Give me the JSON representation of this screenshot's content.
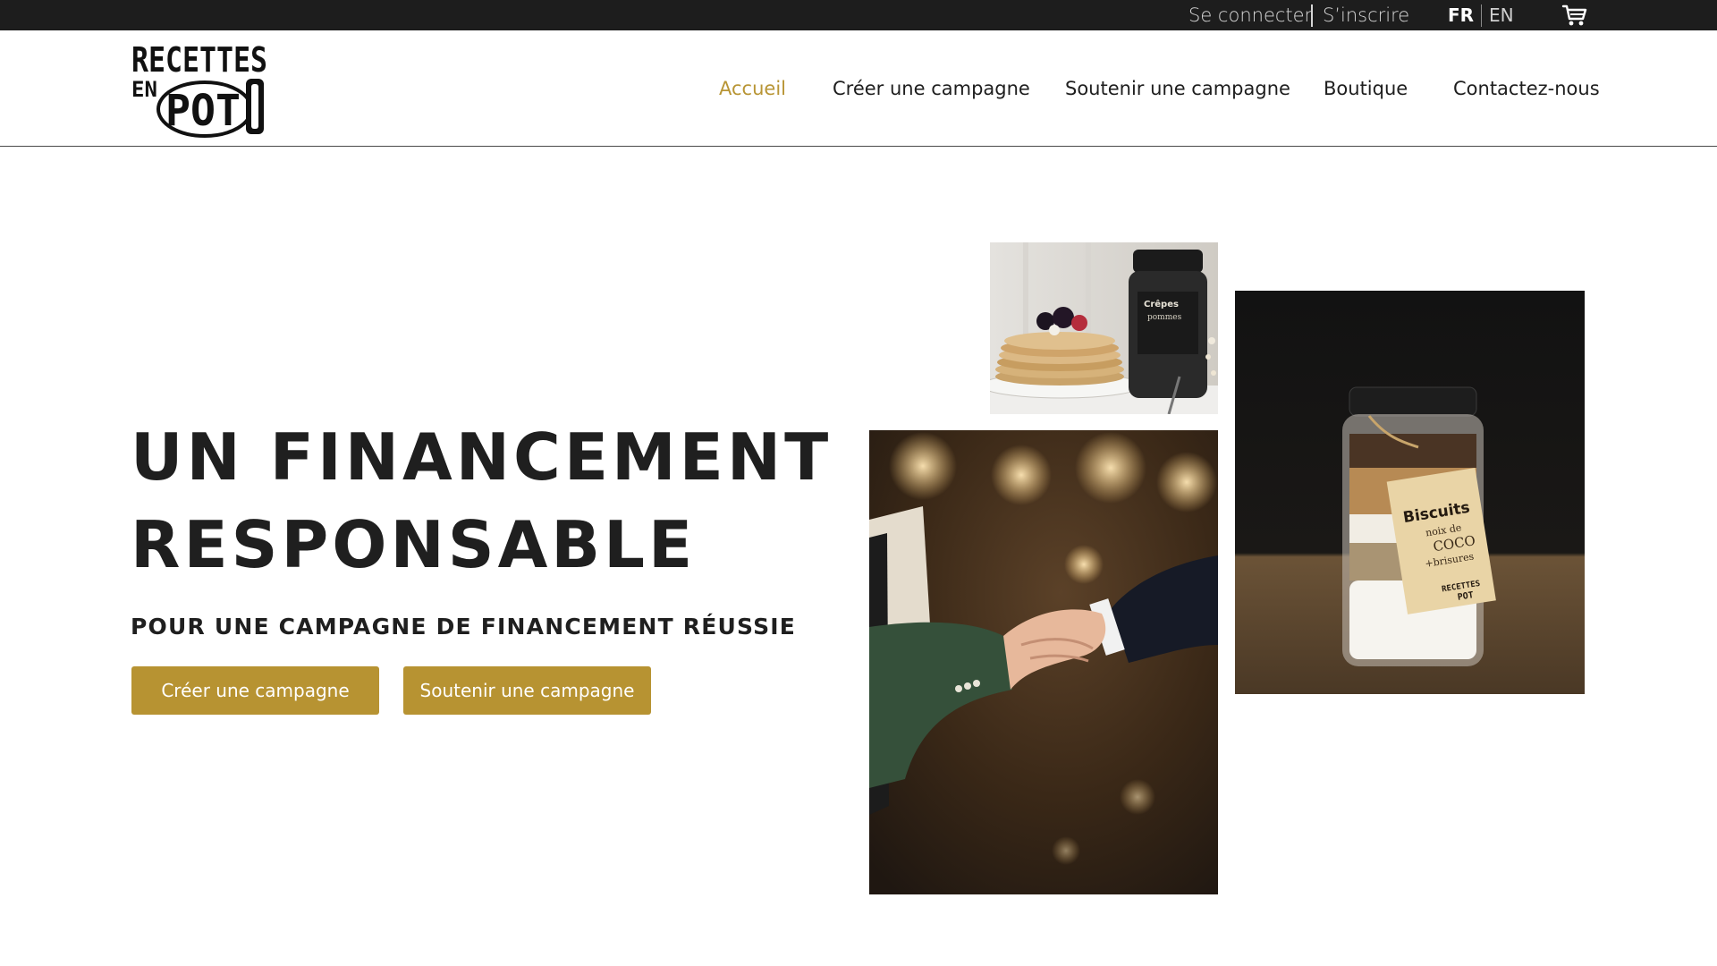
{
  "topbar": {
    "login": "Se connecter",
    "signup": "S’inscrire",
    "lang_fr": "FR",
    "lang_en": "EN",
    "cart_icon": "cart-icon"
  },
  "logo": {
    "line1": "RECETTES",
    "line2": "EN",
    "line3": "POT"
  },
  "nav": {
    "home": "Accueil",
    "create": "Créer une campagne",
    "support": "Soutenir une campagne",
    "shop": "Boutique",
    "contact": "Contactez-nous"
  },
  "hero": {
    "title_line1": "UN FINANCEMENT",
    "title_line2": "RESPONSABLE",
    "subtitle": "POUR UNE CAMPAGNE DE FINANCEMENT RÉUSSIE",
    "btn_create": "Créer une campagne",
    "btn_support": "Soutenir une campagne"
  },
  "photos": {
    "crepes_jar_label_1": "Crêpes",
    "crepes_jar_label_2": "pommes",
    "jar_tag_title": "Biscuits",
    "jar_tag_line1": "noix de",
    "jar_tag_line2": "COCO",
    "jar_tag_line3": "+brisures",
    "jar_tag_brand1": "RECETTES",
    "jar_tag_brand2": "POT"
  },
  "colors": {
    "accent": "#b79332",
    "topbar_bg": "#1d1d1d",
    "text": "#1f1f1f"
  }
}
